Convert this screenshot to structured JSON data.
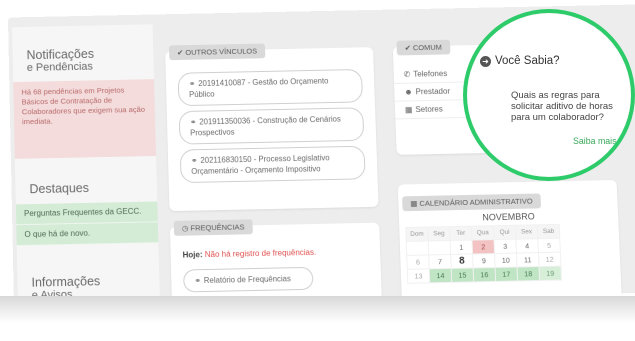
{
  "left": {
    "notif_title": "Notificações",
    "notif_sub": "e Pendências",
    "pending_text": "Há 68 pendências em Projetos Básicos de Contratação de Colaboradores que exigem sua ação imediata.",
    "destaques_title": "Destaques",
    "destaques_items": [
      "Perguntas Frequentes da GECC.",
      "O que há de novo."
    ],
    "info_title": "Informações",
    "info_sub": "e Avisos"
  },
  "outros": {
    "tag": "OUTROS VÍNCULOS",
    "items": [
      "20191410087 - Gestão do Orçamento Público",
      "201911350036 - Construção de Cenários Prospectivos",
      "202116830150 - Processo Legislativo Orçamentário - Orçamento Impositivo"
    ]
  },
  "freq": {
    "tag": "FREQUÊNCIAS",
    "hoje_label": "Hoje:",
    "hoje_value": "Não há registro de frequências.",
    "relatorio": "Relatório de Frequências"
  },
  "comum": {
    "tag": "COMUM",
    "items": [
      "Telefones",
      "Prestador",
      "Setores"
    ]
  },
  "calendar": {
    "tag": "CALENDÁRIO ADMINISTRATIVO",
    "month": "NOVEMBRO",
    "headers": [
      "Dom",
      "Seg",
      "Ter",
      "Qua",
      "Qui",
      "Sex",
      "Sab"
    ],
    "week1": [
      "",
      "",
      "1",
      "2",
      "3",
      "4",
      "5"
    ],
    "week2": [
      "6",
      "7",
      "8",
      "9",
      "10",
      "11",
      "12"
    ],
    "week3": [
      "13",
      "14",
      "15",
      "16",
      "17",
      "18",
      "19"
    ]
  },
  "sabia": {
    "title": "Você Sabia?",
    "question": "Quais as regras para solicitar aditivo de horas para um colaborador?",
    "link": "Saiba mais..."
  },
  "colors": {
    "highlight_ring": "#2dcb6a",
    "pending_bg": "#f4dcdc",
    "green_item_bg": "#d4ebd6",
    "link_green": "#3aa85a",
    "alert_red": "#e05050"
  }
}
